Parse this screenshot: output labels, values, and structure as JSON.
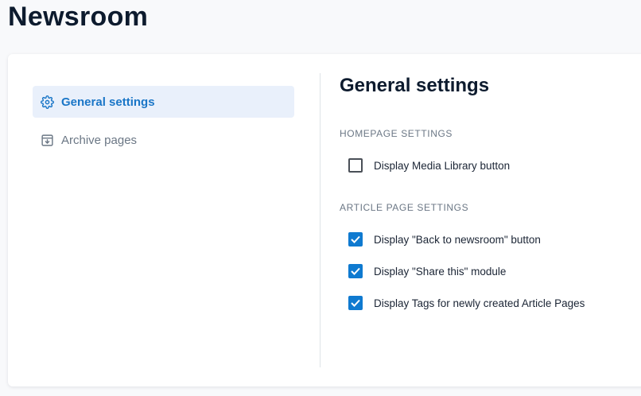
{
  "page": {
    "title": "Newsroom"
  },
  "sidebar": {
    "items": [
      {
        "label": "General settings",
        "icon": "gear-icon",
        "active": true
      },
      {
        "label": "Archive pages",
        "icon": "archive-icon",
        "active": false
      }
    ]
  },
  "main": {
    "title": "General settings",
    "sections": [
      {
        "label": "HOMEPAGE SETTINGS",
        "options": [
          {
            "label": "Display Media Library button",
            "checked": false
          }
        ]
      },
      {
        "label": "ARTICLE PAGE SETTINGS",
        "options": [
          {
            "label": "Display \"Back to newsroom\" button",
            "checked": true
          },
          {
            "label": "Display \"Share this\" module",
            "checked": true
          },
          {
            "label": "Display Tags for newly created Article Pages",
            "checked": true
          }
        ]
      }
    ]
  },
  "colors": {
    "accent": "#0f7ad0",
    "active_bg": "#e9f0fb",
    "muted_text": "#6b7785"
  }
}
